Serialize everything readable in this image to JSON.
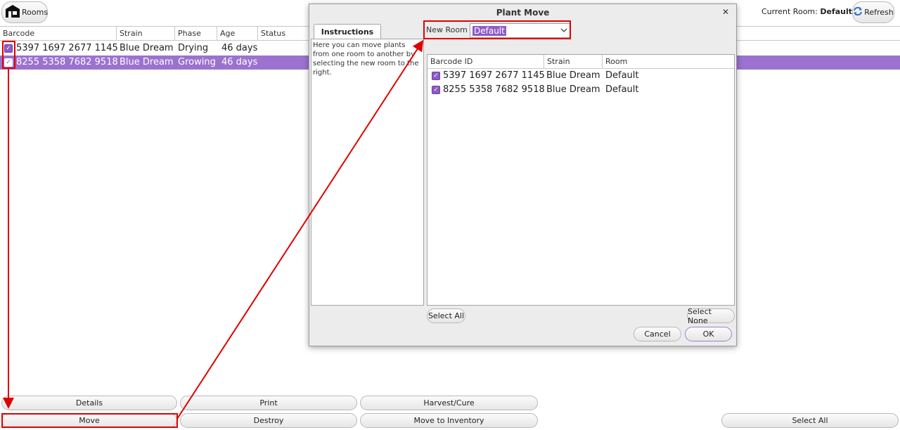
{
  "toolbar": {
    "rooms_label": "Rooms",
    "refresh_label": "Refresh",
    "current_room_label": "Current Room:",
    "current_room_value": "Default"
  },
  "main_table": {
    "columns": [
      "Barcode",
      "Strain",
      "Phase",
      "Age",
      "Status"
    ],
    "rows": [
      {
        "checked": true,
        "barcode": "5397 1697 2677 1145",
        "strain": "Blue Dream",
        "phase": "Drying",
        "age": "46 days",
        "status": "",
        "selected": false
      },
      {
        "checked": true,
        "barcode": "8255 5358 7682 9518",
        "strain": "Blue Dream",
        "phase": "Growing",
        "age": "46 days",
        "status": "",
        "selected": true
      }
    ]
  },
  "actions": {
    "details": "Details",
    "print": "Print",
    "harvest_cure": "Harvest/Cure",
    "move": "Move",
    "destroy": "Destroy",
    "move_to_inventory": "Move to Inventory",
    "select_all": "Select All"
  },
  "dialog": {
    "title": "Plant Move",
    "close_glyph": "✕",
    "tab_label": "Instructions",
    "instructions": "Here you can move plants from one room to another by selecting the new room to the right.",
    "new_room_label": "New Room",
    "new_room_value": "Default",
    "table": {
      "columns": [
        "Barcode ID",
        "Strain",
        "Room"
      ],
      "rows": [
        {
          "checked": true,
          "barcode": "5397 1697 2677 1145",
          "strain": "Blue Dream",
          "room": "Default"
        },
        {
          "checked": true,
          "barcode": "8255 5358 7682 9518",
          "strain": "Blue Dream",
          "room": "Default"
        }
      ]
    },
    "select_all": "Select All",
    "select_none": "Select None",
    "cancel": "Cancel",
    "ok": "OK"
  },
  "colors": {
    "accent": "#9b72d0",
    "annotation": "#e00000"
  }
}
